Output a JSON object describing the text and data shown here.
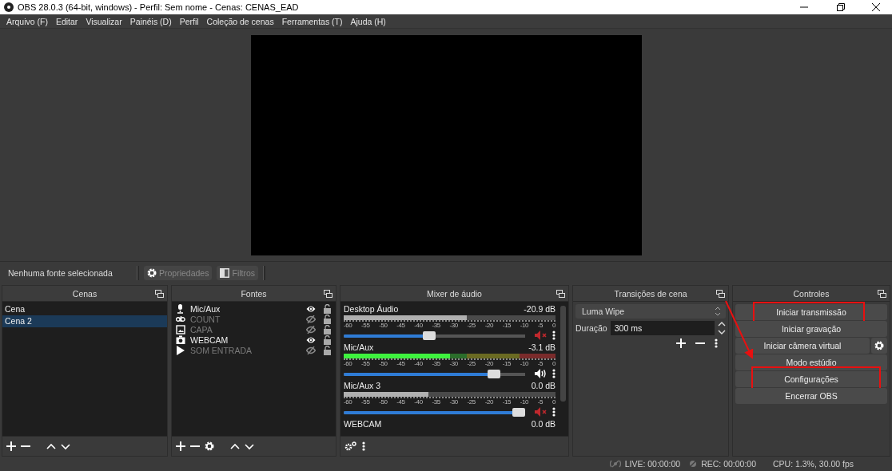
{
  "window": {
    "title": "OBS 28.0.3 (64-bit, windows) - Perfil: Sem nome - Cenas: CENAS_EAD"
  },
  "menu": [
    "Arquivo (F)",
    "Editar",
    "Visualizar",
    "Painéis (D)",
    "Perfil",
    "Coleção de cenas",
    "Ferramentas (T)",
    "Ajuda (H)"
  ],
  "source_toolbar": {
    "status": "Nenhuma fonte selecionada",
    "buttons": [
      {
        "label": "Propriedades",
        "kind": "gear",
        "disabled": true
      },
      {
        "label": "Filtros",
        "kind": "filter",
        "disabled": true
      }
    ]
  },
  "scenes": {
    "title": "Cenas",
    "items": [
      {
        "name": "Cena",
        "selected": false
      },
      {
        "name": "Cena 2",
        "selected": true
      }
    ]
  },
  "sources": {
    "title": "Fontes",
    "items": [
      {
        "name": "Mic/Aux",
        "kind": "mic",
        "visible": true
      },
      {
        "name": "COUNT",
        "kind": "text",
        "visible": false
      },
      {
        "name": "CAPA",
        "kind": "image",
        "visible": false
      },
      {
        "name": "WEBCAM",
        "kind": "camera",
        "visible": true
      },
      {
        "name": "SOM ENTRADA",
        "kind": "media",
        "visible": false
      }
    ]
  },
  "mixer": {
    "title": "Mixer de áudio",
    "channels": [
      {
        "name": "Desktop Áudio",
        "reading": "-20.9 dB",
        "muted": true,
        "meter": {
          "level": 0.58
        },
        "scale": [
          "-60",
          "-55",
          "-50",
          "-45",
          "-40",
          "-35",
          "-30",
          "-25",
          "-20",
          "-15",
          "-10",
          "-5",
          "0"
        ],
        "volume": {
          "level": 0.47
        }
      },
      {
        "name": "Mic/Aux",
        "reading": "-3.1 dB",
        "muted": false,
        "meter": {
          "level": 0.5
        },
        "scale": [
          "-60",
          "-55",
          "-50",
          "-45",
          "-40",
          "-35",
          "-30",
          "-25",
          "-20",
          "-15",
          "-10",
          "-5",
          "0"
        ],
        "volume": {
          "level": 0.83
        }
      },
      {
        "name": "Mic/Aux 3",
        "reading": "0.0 dB",
        "muted": true,
        "meter": {
          "level": 0.4
        },
        "scale": [
          "-60",
          "-55",
          "-50",
          "-45",
          "-40",
          "-35",
          "-30",
          "-25",
          "-20",
          "-15",
          "-10",
          "-5",
          "0"
        ],
        "volume": {
          "level": 0.98
        }
      },
      {
        "name": "WEBCAM",
        "reading": "0.0 dB",
        "kind": "partial"
      }
    ]
  },
  "transitions": {
    "title": "Transições de cena",
    "selected": "Luma Wipe",
    "duration_label": "Duração",
    "duration": "300 ms"
  },
  "controls": {
    "title": "Controles",
    "buttons": [
      {
        "label": "Iniciar transmissão",
        "highlighted": true
      },
      {
        "label": "Iniciar gravação",
        "highlighted": false
      },
      {
        "label": "Iniciar câmera virtual",
        "highlighted": false,
        "kind": "with-gear"
      },
      {
        "label": "Modo estúdio",
        "highlighted": false
      },
      {
        "label": "Configurações",
        "highlighted": true
      },
      {
        "label": "Encerrar OBS",
        "highlighted": false
      }
    ]
  },
  "status_bar": {
    "live": "LIVE: 00:00:00",
    "rec": "REC: 00:00:00",
    "cpu": "CPU: 1.3%, 30.00 fps"
  }
}
